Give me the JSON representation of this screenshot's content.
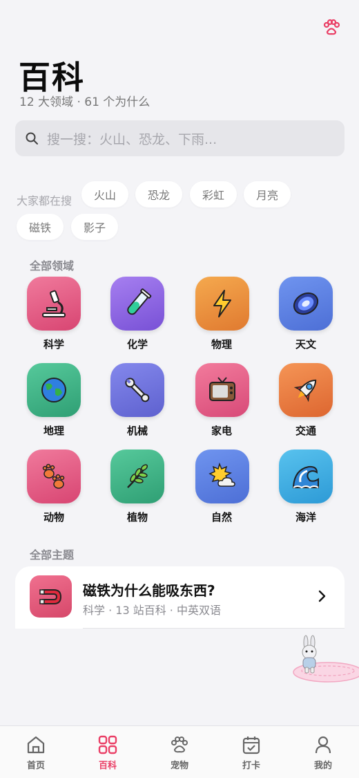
{
  "colors": {
    "accent": "#ea3f66",
    "background": "#f4f4f7"
  },
  "header": {
    "title": "百科",
    "subtitle": "12 大领域 · 61 个为什么",
    "top_icon": "paw-icon"
  },
  "search": {
    "placeholder": "搜一搜：火山、恐龙、下雨..."
  },
  "hot": {
    "label": "大家都在搜",
    "chips": [
      "火山",
      "恐龙",
      "彩虹",
      "月亮",
      "磁铁",
      "影子"
    ]
  },
  "domains": {
    "title": "全部领域",
    "items": [
      {
        "label": "科学",
        "icon": "microscope-icon",
        "color": "#e2577f"
      },
      {
        "label": "化学",
        "icon": "test-tube-icon",
        "color": "#8a63e0"
      },
      {
        "label": "物理",
        "icon": "lightning-icon",
        "color": "#ec8e3a"
      },
      {
        "label": "天文",
        "icon": "galaxy-icon",
        "color": "#5a7ee0"
      },
      {
        "label": "地理",
        "icon": "globe-icon",
        "color": "#3bb389"
      },
      {
        "label": "机械",
        "icon": "wrench-icon",
        "color": "#6c6fd9"
      },
      {
        "label": "家电",
        "icon": "television-icon",
        "color": "#e65a86"
      },
      {
        "label": "交通",
        "icon": "rocket-icon",
        "color": "#e8743f"
      },
      {
        "label": "动物",
        "icon": "paw-prints-icon",
        "color": "#e05a86"
      },
      {
        "label": "植物",
        "icon": "herb-icon",
        "color": "#3aae7e"
      },
      {
        "label": "自然",
        "icon": "sun-cloud-icon",
        "color": "#5a7ee0"
      },
      {
        "label": "海洋",
        "icon": "wave-icon",
        "color": "#33aadb"
      }
    ]
  },
  "topics": {
    "title": "全部主题",
    "cards": [
      {
        "title": "磁铁为什么能吸东西?",
        "meta": "科学 · 13 站百科 · 中英双语",
        "icon": "magnet-icon"
      }
    ]
  },
  "mascot": {
    "icon": "bunny-mascot-icon"
  },
  "tabbar": {
    "tabs": [
      {
        "label": "首页",
        "icon": "home-icon",
        "active": false
      },
      {
        "label": "百科",
        "icon": "grid-icon",
        "active": true
      },
      {
        "label": "宠物",
        "icon": "paw-icon",
        "active": false
      },
      {
        "label": "打卡",
        "icon": "calendar-check-icon",
        "active": false
      },
      {
        "label": "我的",
        "icon": "user-icon",
        "active": false
      }
    ]
  }
}
